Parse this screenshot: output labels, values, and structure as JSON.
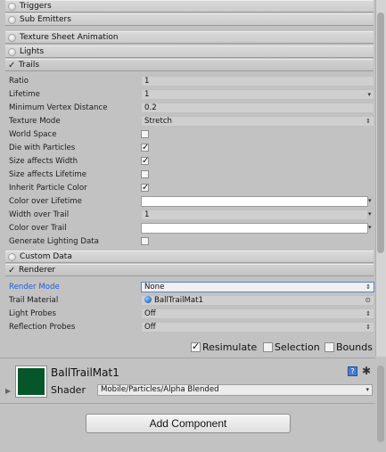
{
  "modules": {
    "triggers": "Triggers",
    "sub_emitters": "Sub Emitters",
    "texture_sheet_animation": "Texture Sheet Animation",
    "lights": "Lights",
    "trails": "Trails",
    "custom_data": "Custom Data",
    "renderer": "Renderer"
  },
  "trails": {
    "ratio_label": "Ratio",
    "ratio_value": "1",
    "lifetime_label": "Lifetime",
    "lifetime_value": "1",
    "min_vertex_label": "Minimum Vertex Distance",
    "min_vertex_value": "0.2",
    "texture_mode_label": "Texture Mode",
    "texture_mode_value": "Stretch",
    "world_space_label": "World Space",
    "world_space_checked": false,
    "die_label": "Die with Particles",
    "die_checked": true,
    "size_width_label": "Size affects Width",
    "size_width_checked": true,
    "size_lifetime_label": "Size affects Lifetime",
    "size_lifetime_checked": false,
    "inherit_color_label": "Inherit Particle Color",
    "inherit_color_checked": true,
    "color_lifetime_label": "Color over Lifetime",
    "width_trail_label": "Width over Trail",
    "width_trail_value": "1",
    "color_trail_label": "Color over Trail",
    "gen_lighting_label": "Generate Lighting Data",
    "gen_lighting_checked": false
  },
  "renderer": {
    "render_mode_label": "Render Mode",
    "render_mode_value": "None",
    "trail_material_label": "Trail Material",
    "trail_material_value": "BallTrailMat1",
    "light_probes_label": "Light Probes",
    "light_probes_value": "Off",
    "reflection_probes_label": "Reflection Probes",
    "reflection_probes_value": "Off"
  },
  "options": {
    "resimulate": "Resimulate",
    "resimulate_checked": true,
    "selection": "Selection",
    "selection_checked": false,
    "bounds": "Bounds",
    "bounds_checked": false
  },
  "material": {
    "name": "BallTrailMat1",
    "shader_label": "Shader",
    "shader_value": "Mobile/Particles/Alpha Blended",
    "swatch_color": "#05572a"
  },
  "add_component": "Add Component",
  "glyphs": {
    "check": "✓",
    "updown": "⇕",
    "down": "▾",
    "target": "⊙",
    "fold": "▶",
    "help": "?",
    "gear": "✱"
  }
}
